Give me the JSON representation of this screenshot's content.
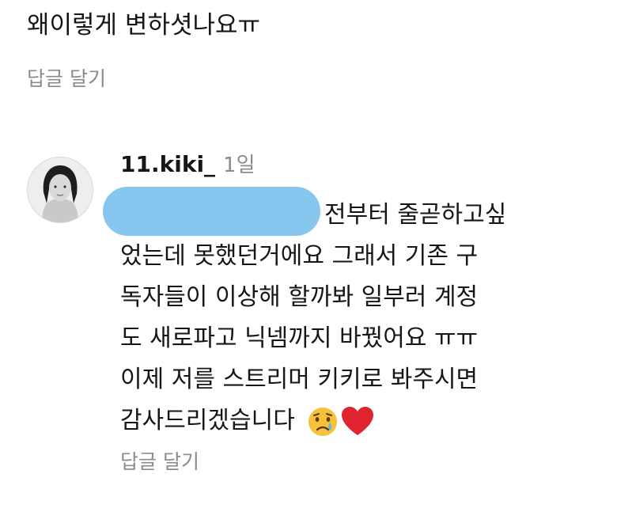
{
  "previous_comment": {
    "text": "왜이렇게 변하셧나요ㅠ",
    "reply_label": "답글 달기"
  },
  "comment": {
    "username": "11.kiki_",
    "time": "1일",
    "lines": [
      "전부터 줄곧하고싶",
      "었는데 못했던거에요 그래서 기존 구",
      "독자들이 이상해 할까봐 일부러 계정",
      "도 새로파고 닉넴까지 바꿨어요 ㅠㅠ",
      "이제 저를 스트리머 키키로 봐주시면",
      "감사드리겠습니다"
    ],
    "emojis": [
      "crying-face-emoji",
      "red-heart-emoji"
    ],
    "reply_label": "답글 달기"
  },
  "colors": {
    "text": "#161616",
    "muted": "#8b8b8b",
    "redaction": "#87c6ef",
    "heart": "#e0242f"
  }
}
